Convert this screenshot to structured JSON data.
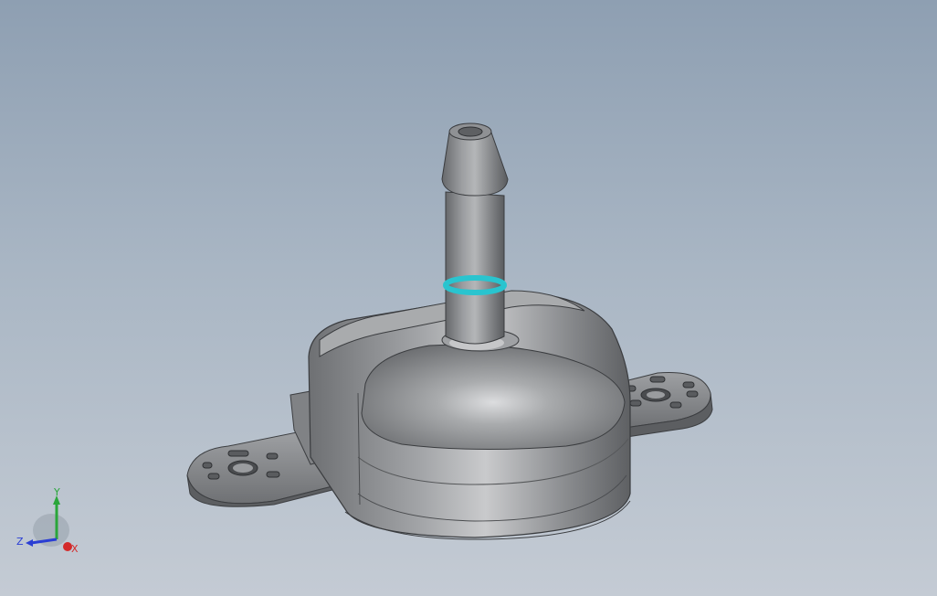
{
  "viewport": {
    "background_top": "#8e9fb2",
    "background_bottom": "#c4cbd4"
  },
  "model": {
    "part": "sensor-housing-with-hose-barb",
    "body_color": "#8f9194",
    "seal_ring_color": "#29c4cf"
  },
  "triad": {
    "x_label": "X",
    "y_label": "Y",
    "z_label": "Z",
    "x_color": "#d42a2a",
    "y_color": "#2aa63a",
    "z_color": "#2a3ed4"
  }
}
